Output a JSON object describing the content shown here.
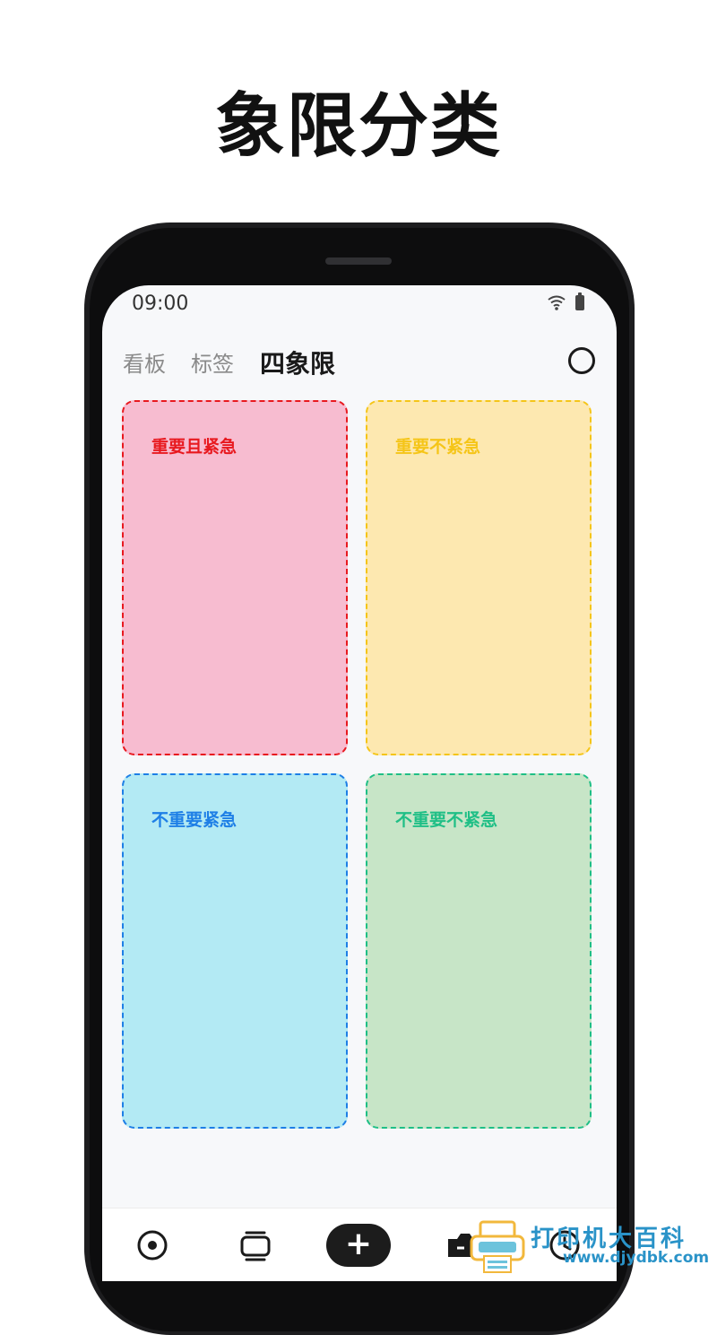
{
  "headline": "象限分类",
  "status_bar": {
    "time": "09:00"
  },
  "tabs": [
    {
      "label": "看板",
      "active": false
    },
    {
      "label": "标签",
      "active": false
    },
    {
      "label": "四象限",
      "active": true
    }
  ],
  "quadrants": [
    {
      "label": "重要且紧急",
      "fill": "#f7bcd0",
      "accent": "#e8191f"
    },
    {
      "label": "重要不紧急",
      "fill": "#fde8b0",
      "accent": "#f5c518"
    },
    {
      "label": "不重要紧急",
      "fill": "#b3eaf4",
      "accent": "#1e7fe6"
    },
    {
      "label": "不重要不紧急",
      "fill": "#c7e5c7",
      "accent": "#1fbf86"
    }
  ],
  "bottom_nav": {
    "items": [
      "target-icon",
      "cards-icon",
      "add-button",
      "camera-icon",
      "clock-icon"
    ],
    "add_label": "+"
  },
  "watermark": {
    "text": "打印机大百科",
    "url": "www.djydbk.com"
  }
}
